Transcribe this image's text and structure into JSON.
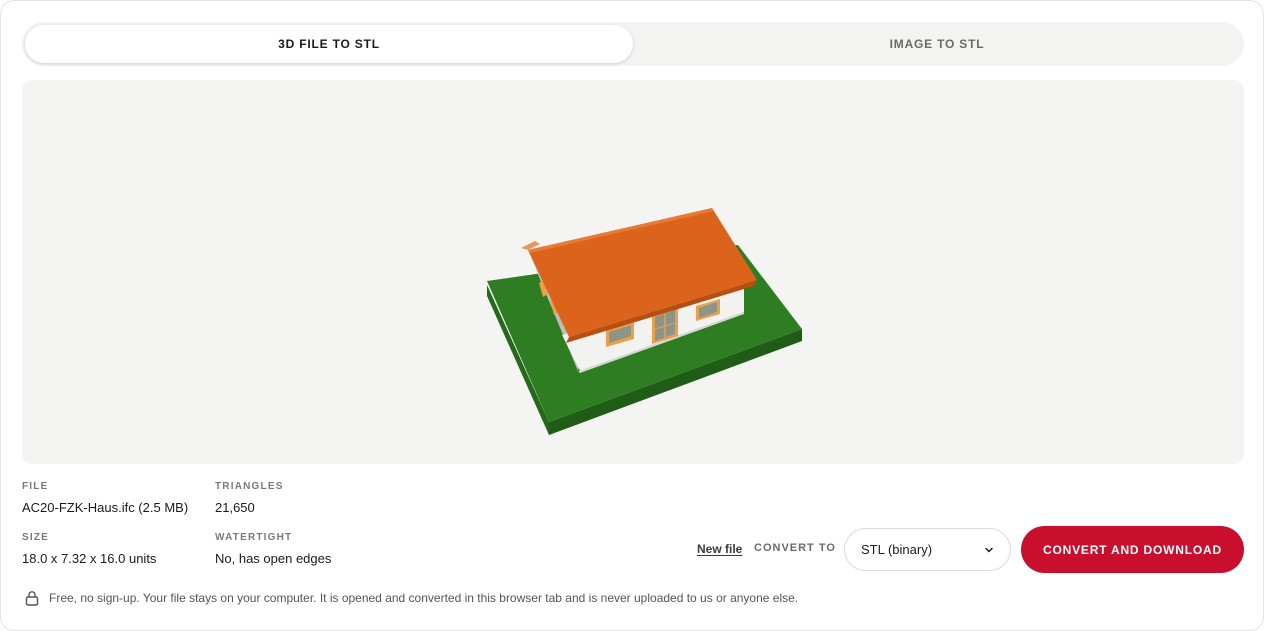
{
  "tabs": [
    {
      "label": "3D FILE TO STL",
      "active": true
    },
    {
      "label": "IMAGE TO STL",
      "active": false
    }
  ],
  "model": {
    "icon": "house-model-preview",
    "colors": {
      "ground": "#2f7d23",
      "roof": "#db631b",
      "walls": "#f2f2f0",
      "window_frame": "#e7a14b",
      "window_glass": "#8d9488"
    }
  },
  "info": {
    "file": {
      "label": "FILE",
      "value": "AC20-FZK-Haus.ifc (2.5 MB)"
    },
    "triangles": {
      "label": "TRIANGLES",
      "value": "21,650"
    },
    "size": {
      "label": "SIZE",
      "value": "18.0 x 7.32 x 16.0 units"
    },
    "watertight": {
      "label": "WATERTIGHT",
      "value": "No, has open edges"
    }
  },
  "actions": {
    "new_file": "New file",
    "convert_to_label": "CONVERT TO",
    "format": "STL (binary)",
    "convert_button": "CONVERT AND DOWNLOAD"
  },
  "notice": "Free, no sign-up. Your file stays on your computer. It is opened and converted in this browser tab and is never uploaded to us or anyone else.",
  "colors": {
    "accent": "#c8102e",
    "panel": "#f4f4f2"
  }
}
